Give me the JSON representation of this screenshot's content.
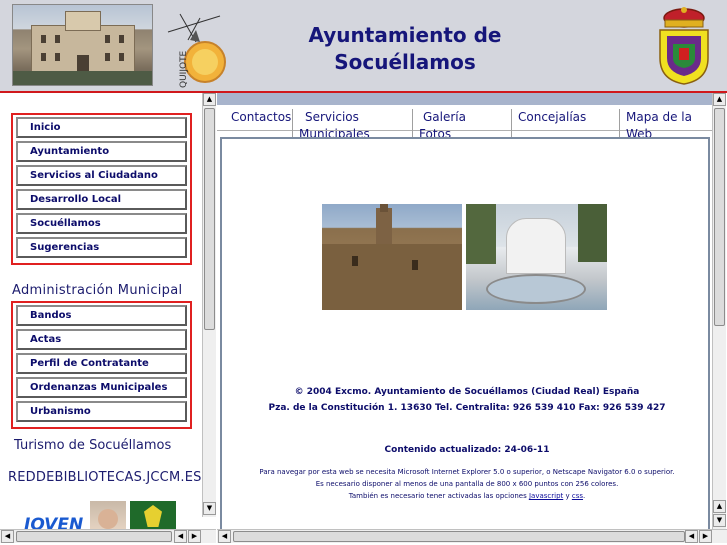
{
  "header": {
    "title_line1": "Ayuntamiento de",
    "title_line2": "Socuéllamos",
    "quijote_text": "QUIJOTE"
  },
  "left_menu": {
    "main_items": [
      "Inicio",
      "Ayuntamiento",
      "Servicios al Ciudadano",
      "Desarrollo Local",
      "Socuéllamos",
      "Sugerencias"
    ],
    "admin_title": "Administración Municipal",
    "admin_items": [
      "Bandos",
      "Actas",
      "Perfil de Contratante",
      "Ordenanzas Municipales",
      "Urbanismo"
    ],
    "turismo_link": "Turismo de Socuéllamos",
    "biblio_link": "REDDEBIBLIOTECAS.JCCM.ES",
    "banner_text": "JOVEN"
  },
  "nav_tabs": [
    {
      "line1": "Contactos",
      "line2": ""
    },
    {
      "line1": "Servicios",
      "line2": "Municipales"
    },
    {
      "line1": "Galería",
      "line2": "Fotos"
    },
    {
      "line1": "Concejalías",
      "line2": ""
    },
    {
      "line1": "Mapa de la",
      "line2": "Web"
    }
  ],
  "content": {
    "copyright": "© 2004 Excmo. Ayuntamiento de Socuéllamos  (Ciudad Real)  España",
    "address": "Pza. de la Constitución 1. 13630 Tel. Centralita: 926 539 410 Fax: 926 539 427",
    "updated": "Contenido actualizado: 24-06-11",
    "note1": "Para navegar por esta web se necesita Microsoft Internet Explorer 5.0 o superior, o Netscape Navigator 6.0 o superior.",
    "note2": "Es necesario disponer al menos de una pantalla de 800 x 600 puntos con 256 colores.",
    "note3_prefix": "También es necesario tener activadas las opciones ",
    "note3_link1": "Javascript",
    "note3_mid": " y ",
    "note3_link2": "css",
    "note3_suffix": "."
  },
  "colors": {
    "header_bg": "#d4d6dd",
    "accent_red": "#d0181c",
    "title_blue": "#16167a",
    "nav_strip": "#a8b4cc"
  }
}
